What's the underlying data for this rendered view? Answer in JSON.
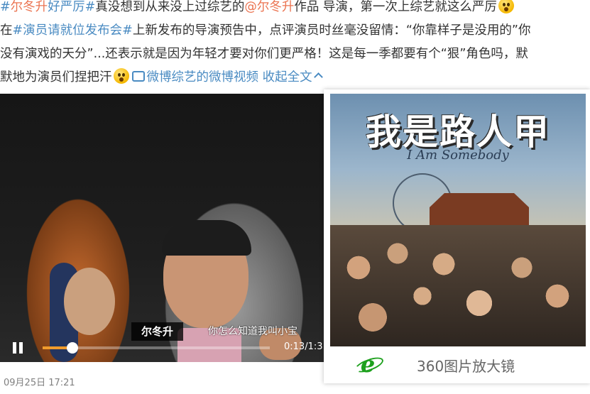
{
  "post": {
    "line1": {
      "topic1_open": "#",
      "topic1_name": "尔冬升",
      "topic1_rest": "好严厉#",
      "text1": "真没想到从来没上过综艺的",
      "mention": "@尔冬升",
      "mention_suffix": "作品",
      "text2": " 导演，第一次上综艺就这么严厉"
    },
    "line2": {
      "prefix": "在",
      "topic2": "#演员请就位发布会#",
      "text": "上新发布的导演预告中，点评演员时丝毫没留情：“你靠样子是没用的”你"
    },
    "line3": {
      "text": "没有演戏的天分”...还表示就是因为年轻才要对你们更严格！这是每一季都要有个“狠”角色吗，默"
    },
    "line4": {
      "text": "默地为演员们捏把汗",
      "video_link": "微博综艺的微博视频",
      "collapse": "收起全文"
    },
    "emoji_icon": "shocked-face-emoji",
    "emoji2_icon": "sweat-face-emoji"
  },
  "video": {
    "speaker_name": "尔冬升",
    "subtitle": "你怎么知道我叫小宝",
    "time": "0:13/1:3",
    "progress_fraction": 0.13,
    "accent_color": "#f09b2c"
  },
  "image_panel": {
    "poster_title": "我是路人甲",
    "poster_subtitle": "I Am Somebody",
    "magnifier_label": "360图片放大镜",
    "magnifier_icon": "ie-e-icon",
    "icon_color": "#1da01d"
  },
  "timestamp": "09月25日 17:21",
  "colors": {
    "link": "#eb7350",
    "topic": "#4a8bc2",
    "text": "#333333"
  }
}
